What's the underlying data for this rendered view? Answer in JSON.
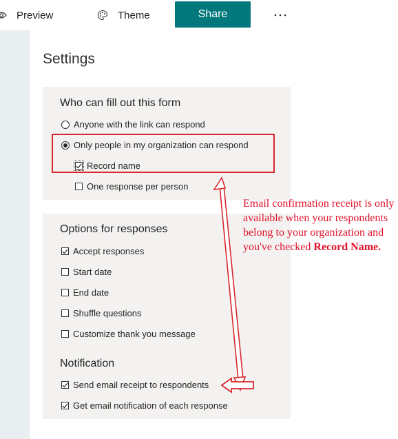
{
  "toolbar": {
    "preview_label": "Preview",
    "theme_label": "Theme",
    "share_label": "Share",
    "more_label": "···",
    "icons": {
      "preview": "eye-icon",
      "theme": "palette-icon",
      "more": "more-icon"
    },
    "share_color": "#03787c"
  },
  "settings": {
    "title": "Settings",
    "who": {
      "heading": "Who can fill out this form",
      "anyone_label": "Anyone with the link can respond",
      "anyone_selected": false,
      "org_label": "Only people in my organization can respond",
      "org_selected": true,
      "record_name_label": "Record name",
      "record_name_checked": true,
      "one_response_label": "One response per person",
      "one_response_checked": false
    },
    "options": {
      "heading": "Options for responses",
      "accept_label": "Accept responses",
      "accept_checked": true,
      "start_date_label": "Start date",
      "start_date_checked": false,
      "end_date_label": "End date",
      "end_date_checked": false,
      "shuffle_label": "Shuffle questions",
      "shuffle_checked": false,
      "thank_you_label": "Customize thank you message",
      "thank_you_checked": false
    },
    "notification": {
      "heading": "Notification",
      "email_receipt_label": "Send email receipt to respondents",
      "email_receipt_checked": true,
      "email_notify_label": "Get email notification of each response",
      "email_notify_checked": true
    }
  },
  "annotation": {
    "text": "Email confirmation receipt is only available when your respondents belong to your organization and you've checked",
    "bold_text": "Record Name.",
    "color": "#e0102a"
  }
}
